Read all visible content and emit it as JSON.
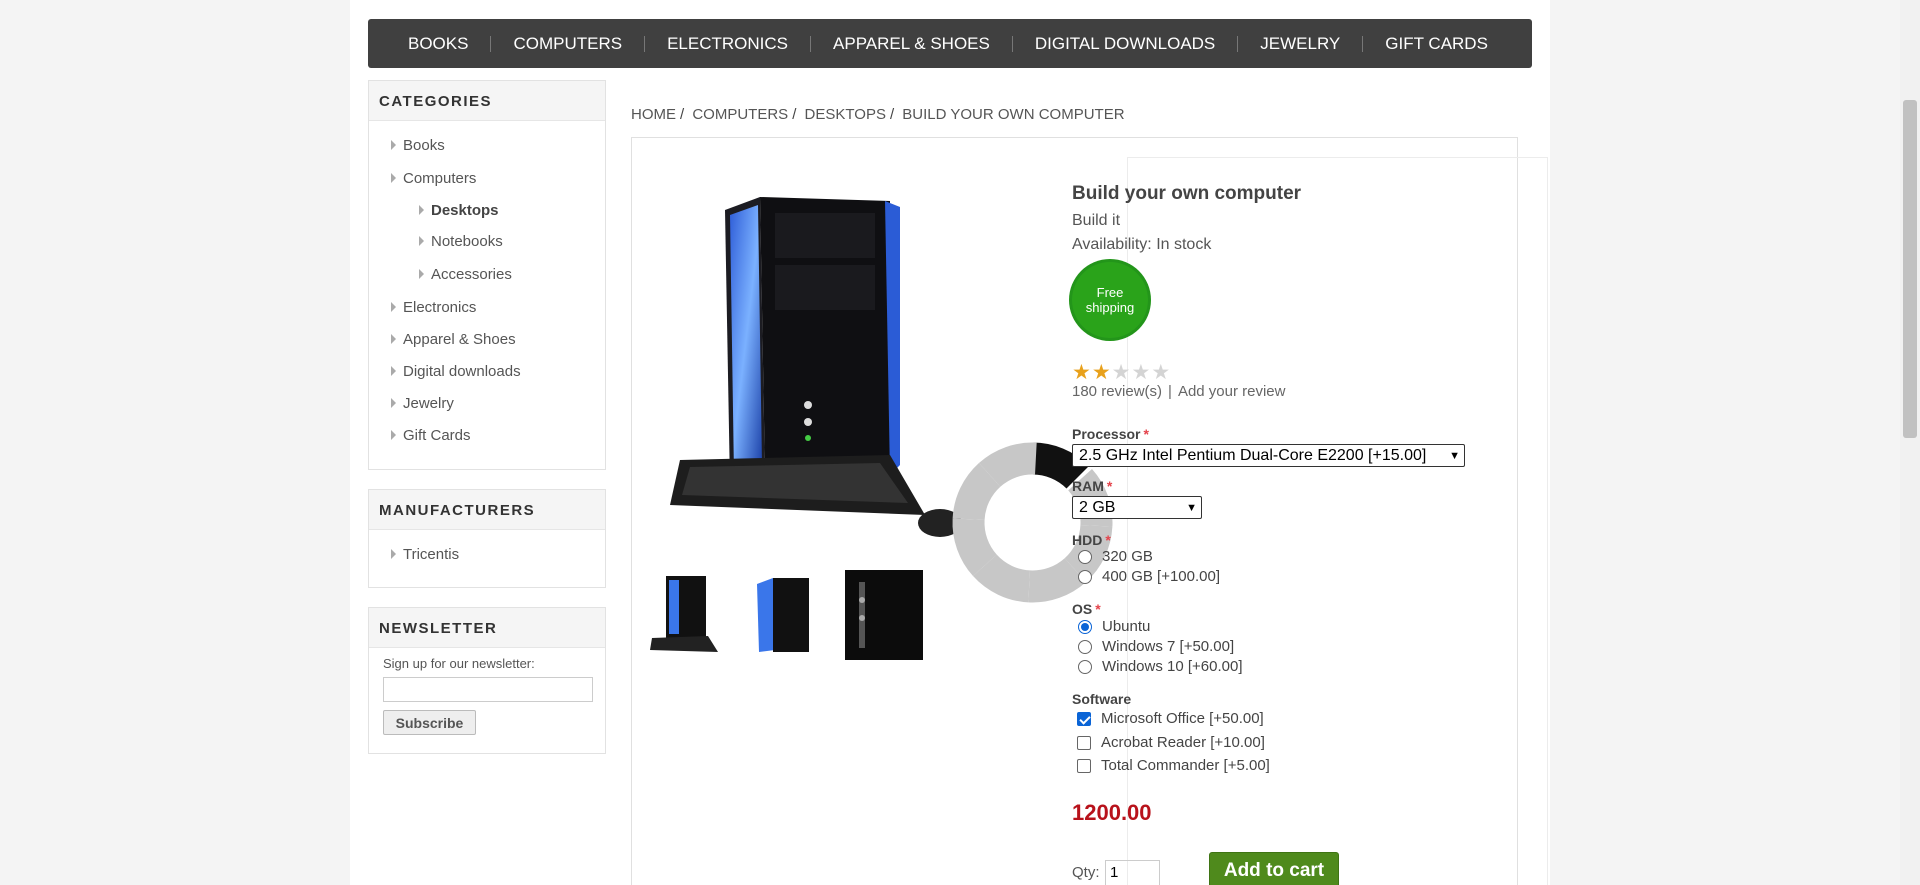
{
  "topnav": [
    "BOOKS",
    "COMPUTERS",
    "ELECTRONICS",
    "APPAREL & SHOES",
    "DIGITAL DOWNLOADS",
    "JEWELRY",
    "GIFT CARDS"
  ],
  "categories": {
    "title": "CATEGORIES",
    "items": [
      {
        "label": "Books",
        "level": 0
      },
      {
        "label": "Computers",
        "level": 0
      },
      {
        "label": "Desktops",
        "level": 1,
        "active": true
      },
      {
        "label": "Notebooks",
        "level": 1
      },
      {
        "label": "Accessories",
        "level": 1
      },
      {
        "label": "Electronics",
        "level": 0
      },
      {
        "label": "Apparel & Shoes",
        "level": 0
      },
      {
        "label": "Digital downloads",
        "level": 0
      },
      {
        "label": "Jewelry",
        "level": 0
      },
      {
        "label": "Gift Cards",
        "level": 0
      }
    ]
  },
  "manufacturers": {
    "title": "MANUFACTURERS",
    "items": [
      "Tricentis"
    ]
  },
  "newsletter": {
    "title": "NEWSLETTER",
    "label": "Sign up for our newsletter:",
    "input_value": "",
    "button": "Subscribe"
  },
  "breadcrumb": [
    "HOME",
    "COMPUTERS",
    "DESKTOPS",
    "BUILD YOUR OWN COMPUTER"
  ],
  "product": {
    "name": "Build your own computer",
    "short_description": "Build it",
    "availability": "Availability: In stock",
    "badge": "Free shipping",
    "rating": 2,
    "rating_max": 5,
    "reviews": "180 review(s)",
    "add_review": "Add your review",
    "price": "1200.00",
    "qty_label": "Qty:",
    "qty_value": "1",
    "add_to_cart": "Add to cart"
  },
  "attributes": {
    "processor": {
      "label": "Processor",
      "selected": "2.5 GHz Intel Pentium Dual-Core E2200 [+15.00]"
    },
    "ram": {
      "label": "RAM",
      "selected": "2 GB"
    },
    "hdd": {
      "label": "HDD",
      "options": [
        "320 GB",
        "400 GB [+100.00]"
      ]
    },
    "os": {
      "label": "OS",
      "options": [
        "Ubuntu",
        "Windows 7 [+50.00]",
        "Windows 10 [+60.00]"
      ],
      "selected": "Ubuntu"
    },
    "software": {
      "label": "Software",
      "options": [
        "Microsoft Office [+50.00]",
        "Acrobat Reader [+10.00]",
        "Total Commander [+5.00]"
      ],
      "checked": [
        "Microsoft Office [+50.00]"
      ]
    }
  },
  "colors": {
    "accent": "#4f8a1c",
    "price": "#b8121b",
    "nav": "#404040",
    "badge": "#2aa31a"
  }
}
